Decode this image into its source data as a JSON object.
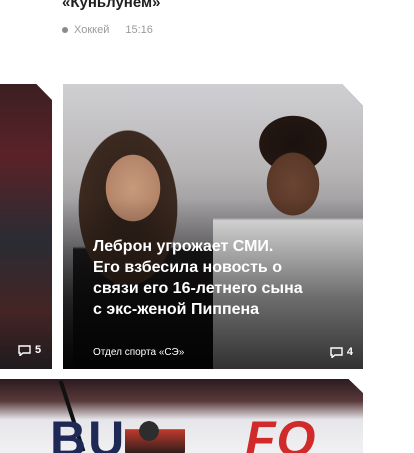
{
  "previous_item": {
    "title": "«Куньлунем»",
    "category": "Хоккей",
    "time": "15:16"
  },
  "left_card": {
    "comments": "5"
  },
  "main_card": {
    "headline": "Леброн угрожает СМИ. Его взбесила новость о связи его 16-летнего сына с экс-женой Пиппена",
    "author": "Отдел спорта «СЭ»",
    "comments": "4"
  },
  "bottom_card": {
    "banner_left": "BU",
    "banner_right": "FO"
  },
  "icons": {
    "comment": "comment-bubble-icon",
    "dot": "category-dot-icon"
  }
}
